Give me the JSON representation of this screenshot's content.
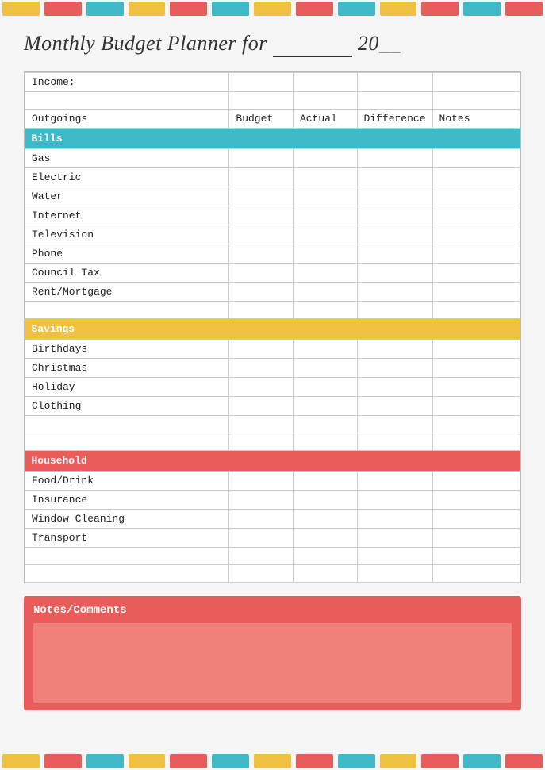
{
  "page": {
    "title": "Monthly Budget Planner for",
    "title_year_prefix": "20",
    "title_year_suffix": "__",
    "title_line": "________"
  },
  "color_bars": {
    "top": [
      "yellow",
      "red",
      "teal",
      "yellow",
      "red",
      "teal",
      "yellow",
      "red",
      "teal",
      "yellow",
      "red",
      "teal",
      "red"
    ],
    "bottom": [
      "yellow",
      "red",
      "teal",
      "yellow",
      "red",
      "teal",
      "yellow",
      "red",
      "teal",
      "yellow",
      "red",
      "teal",
      "red"
    ]
  },
  "table": {
    "income_label": "Income:",
    "headers": {
      "outgoings": "Outgoings",
      "budget": "Budget",
      "actual": "Actual",
      "difference": "Difference",
      "notes": "Notes"
    },
    "categories": [
      {
        "name": "Bills",
        "type": "bills",
        "items": [
          "Gas",
          "Electric",
          "Water",
          "Internet",
          "Television",
          "Phone",
          "Council Tax",
          "Rent/Mortgage"
        ],
        "extra_empty": 1
      },
      {
        "name": "Savings",
        "type": "savings",
        "items": [
          "Birthdays",
          "Christmas",
          "Holiday",
          "Clothing"
        ],
        "extra_empty": 2
      },
      {
        "name": "Household",
        "type": "household",
        "items": [
          "Food/Drink",
          "Insurance",
          "Window Cleaning",
          "Transport"
        ],
        "extra_empty": 2
      }
    ]
  },
  "notes_section": {
    "title": "Notes/Comments"
  }
}
